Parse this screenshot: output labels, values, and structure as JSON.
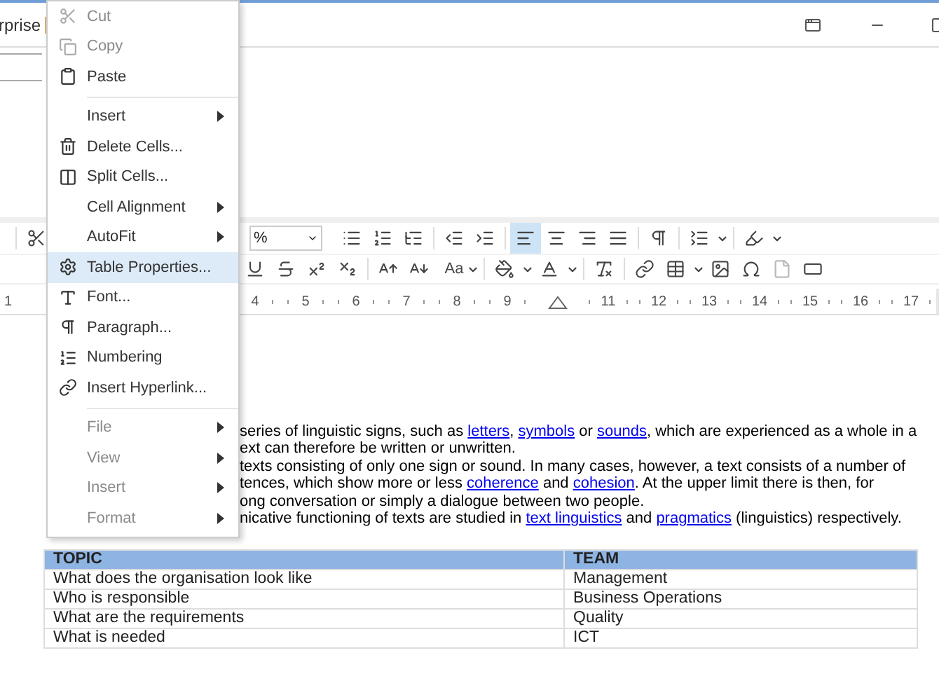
{
  "title_bar": {
    "title": "rprise"
  },
  "toolbar": {
    "zoom_value": "%",
    "case_label": "Aa",
    "align_buttons": [
      {
        "selected": true
      },
      {
        "selected": false
      },
      {
        "selected": false
      },
      {
        "selected": false
      }
    ]
  },
  "ruler": {
    "left_label": "1",
    "marks": [
      {
        "kind": "number",
        "label": "4"
      },
      {
        "kind": "number",
        "label": "5"
      },
      {
        "kind": "number",
        "label": "6"
      },
      {
        "kind": "number",
        "label": "7"
      },
      {
        "kind": "number",
        "label": "8"
      },
      {
        "kind": "number",
        "label": "9"
      },
      {
        "kind": "indent"
      },
      {
        "kind": "number",
        "label": "11"
      },
      {
        "kind": "number",
        "label": "12"
      },
      {
        "kind": "number",
        "label": "13"
      },
      {
        "kind": "number",
        "label": "14"
      },
      {
        "kind": "number",
        "label": "15"
      },
      {
        "kind": "number",
        "label": "16"
      },
      {
        "kind": "number",
        "label": "17"
      }
    ]
  },
  "paragraph_lines": [
    [
      {
        "text": "series of linguistic signs, such as "
      },
      {
        "text": "letters",
        "link": true
      },
      {
        "text": ", "
      },
      {
        "text": "symbols",
        "link": true
      },
      {
        "text": " or "
      },
      {
        "text": "sounds",
        "link": true
      },
      {
        "text": ", which are experienced as a whole in a"
      }
    ],
    [
      {
        "text": "ext can therefore be written or unwritten."
      }
    ],
    [
      {
        "text": "texts consisting of only one sign or sound. In many cases, however, a text consists of a number of"
      }
    ],
    [
      {
        "text": "tences, which show more or less "
      },
      {
        "text": "coherence",
        "link": true
      },
      {
        "text": " and "
      },
      {
        "text": "cohesion",
        "link": true
      },
      {
        "text": ". At the upper limit there is then, for"
      }
    ],
    [
      {
        "text": "ong conversation or simply a dialogue between two people."
      }
    ],
    [
      {
        "text": "nicative functioning of texts are studied in "
      },
      {
        "text": "text linguistics",
        "link": true
      },
      {
        "text": " and "
      },
      {
        "text": "pragmatics",
        "link": true
      },
      {
        "text": " (linguistics) respectively."
      }
    ]
  ],
  "table": {
    "columns": [
      "TOPIC",
      "TEAM"
    ],
    "rows": [
      [
        "What does the organisation look like",
        "Management"
      ],
      [
        "Who is responsible",
        "Business Operations"
      ],
      [
        "What are the requirements",
        "Quality"
      ],
      [
        "What is needed",
        "ICT"
      ]
    ]
  },
  "context_menu": [
    {
      "kind": "item",
      "label": "Cut",
      "disabled": true,
      "submenu": false,
      "selected": false
    },
    {
      "kind": "item",
      "label": "Copy",
      "disabled": true,
      "submenu": false,
      "selected": false
    },
    {
      "kind": "item",
      "label": "Paste",
      "disabled": false,
      "submenu": false,
      "selected": false
    },
    {
      "kind": "separator"
    },
    {
      "kind": "item",
      "label": "Insert",
      "disabled": false,
      "submenu": true,
      "selected": false
    },
    {
      "kind": "item",
      "label": "Delete Cells...",
      "disabled": false,
      "submenu": false,
      "selected": false
    },
    {
      "kind": "item",
      "label": "Split Cells...",
      "disabled": false,
      "submenu": false,
      "selected": false
    },
    {
      "kind": "item",
      "label": "Cell Alignment",
      "disabled": false,
      "submenu": true,
      "selected": false
    },
    {
      "kind": "item",
      "label": "AutoFit",
      "disabled": false,
      "submenu": true,
      "selected": false
    },
    {
      "kind": "item",
      "label": "Table Properties...",
      "disabled": false,
      "submenu": false,
      "selected": true
    },
    {
      "kind": "item",
      "label": "Font...",
      "disabled": false,
      "submenu": false,
      "selected": false
    },
    {
      "kind": "item",
      "label": "Paragraph...",
      "disabled": false,
      "submenu": false,
      "selected": false
    },
    {
      "kind": "item",
      "label": "Numbering",
      "disabled": false,
      "submenu": false,
      "selected": false
    },
    {
      "kind": "item",
      "label": "Insert Hyperlink...",
      "disabled": false,
      "submenu": false,
      "selected": false
    },
    {
      "kind": "separator"
    },
    {
      "kind": "item",
      "label": "File",
      "disabled": true,
      "submenu": true,
      "selected": false
    },
    {
      "kind": "item",
      "label": "View",
      "disabled": true,
      "submenu": true,
      "selected": false
    },
    {
      "kind": "item",
      "label": "Insert",
      "disabled": true,
      "submenu": true,
      "selected": false
    },
    {
      "kind": "item",
      "label": "Format",
      "disabled": true,
      "submenu": true,
      "selected": false
    }
  ]
}
